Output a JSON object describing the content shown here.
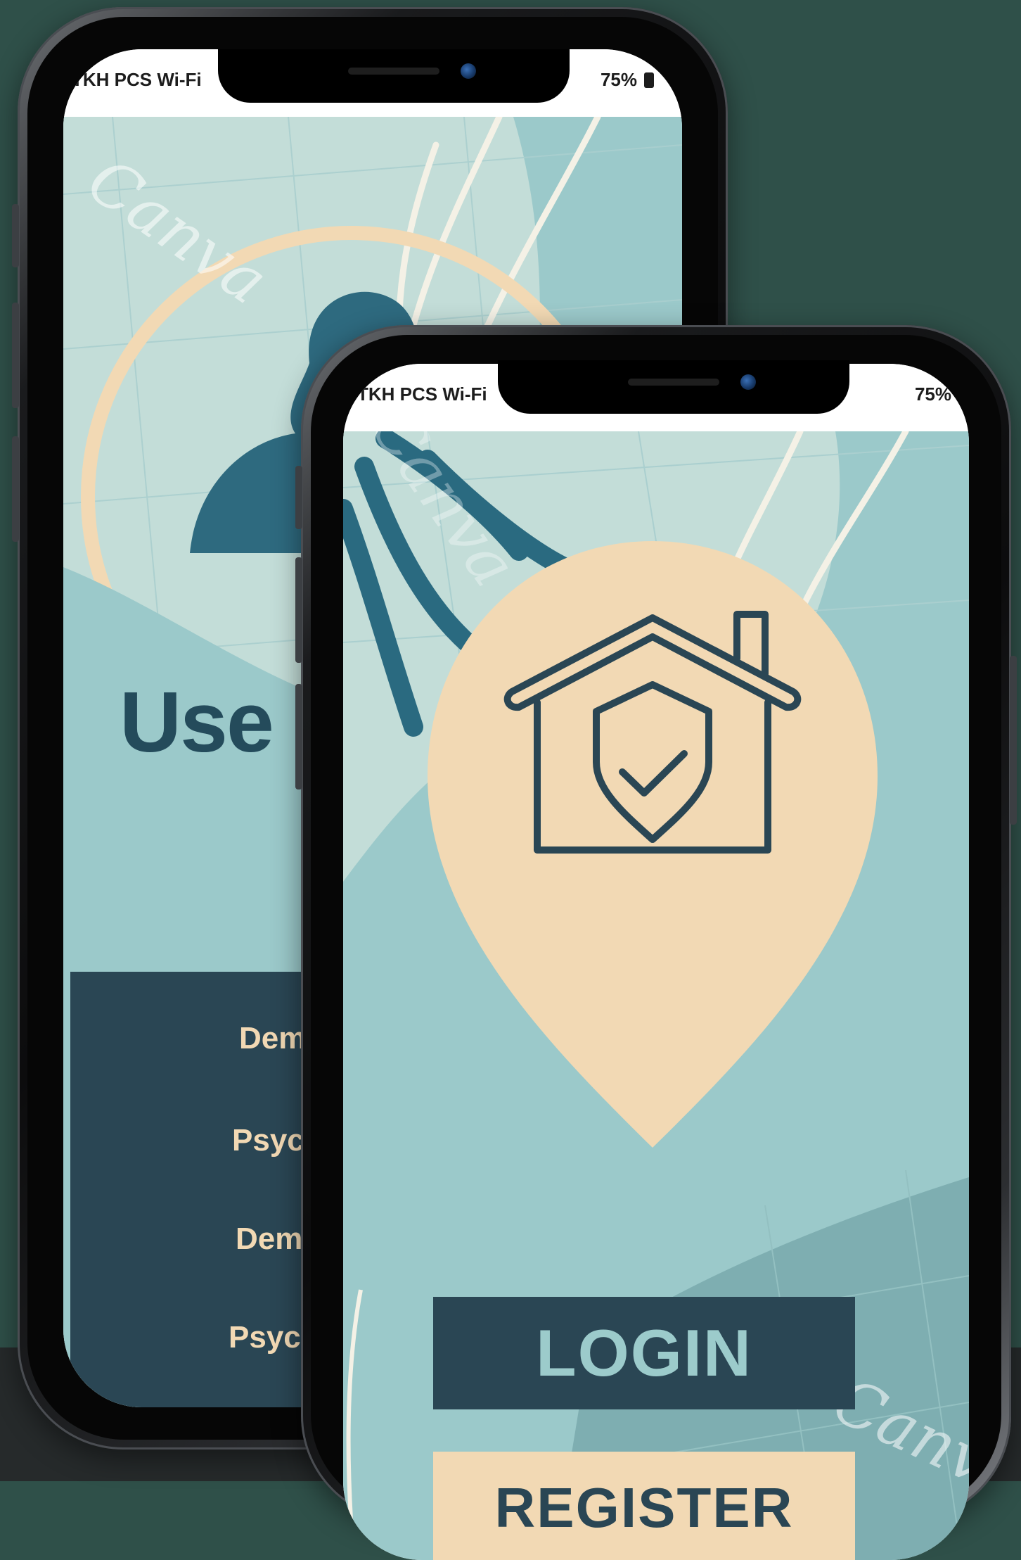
{
  "background_color": "#2f5049",
  "phone_back": {
    "status_bar": {
      "carrier": "TKH PCS Wi-Fi",
      "battery": "75%"
    },
    "title": "Use",
    "menu_items": [
      "Dem",
      "Psyc",
      "Dem",
      "Psych"
    ],
    "watermark": "Canva"
  },
  "phone_front": {
    "status_bar": {
      "carrier": "TKH PCS Wi-Fi",
      "battery": "75%"
    },
    "logo_icon": "home-security-pin-icon",
    "login_label": "LOGIN",
    "register_label": "REGISTER",
    "watermark": "Canva"
  },
  "colors": {
    "teal": "#9bc9ca",
    "navy": "#2a4654",
    "peach": "#f2d9b4"
  }
}
